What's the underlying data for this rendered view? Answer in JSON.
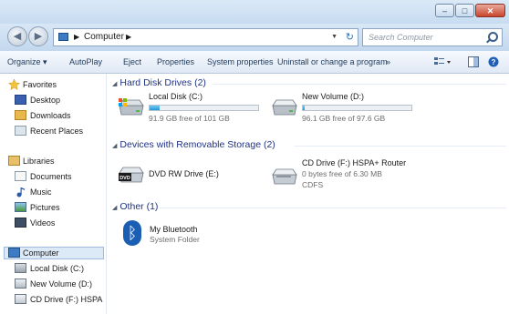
{
  "window": {
    "caption_buttons": [
      "–",
      "□",
      "✕"
    ]
  },
  "address_bar": {
    "path_label": "Computer",
    "search_placeholder": "Search Computer"
  },
  "toolbar": {
    "organize": "Organize ▾",
    "autoplay": "AutoPlay",
    "eject": "Eject",
    "properties": "Properties",
    "system_properties": "System properties",
    "uninstall": "Uninstall or change a program",
    "more": "»"
  },
  "sidebar": {
    "favorites": "Favorites",
    "desktop": "Desktop",
    "downloads": "Downloads",
    "recent": "Recent Places",
    "libraries": "Libraries",
    "documents": "Documents",
    "music": "Music",
    "pictures": "Pictures",
    "videos": "Videos",
    "computer": "Computer",
    "local_disk": "Local Disk (C:)",
    "new_volume": "New Volume (D:)",
    "cd_drive": "CD Drive (F:) HSPA"
  },
  "groups": {
    "hard_disk": "Hard Disk Drives (2)",
    "removable": "Devices with Removable Storage (2)",
    "other": "Other (1)"
  },
  "drives": {
    "c": {
      "name": "Local Disk (C:)",
      "free": "91.9 GB free of 101 GB",
      "used_fraction": 0.09
    },
    "d": {
      "name": "New Volume (D:)",
      "free": "96.1 GB free of 97.6 GB",
      "used_fraction": 0.015
    },
    "e": {
      "name": "DVD RW Drive (E:)"
    },
    "f": {
      "name": "CD Drive (F:) HSPA+ Router",
      "free": "0 bytes free of 6.30 MB",
      "fs": "CDFS"
    }
  },
  "other": {
    "bluetooth_name": "My Bluetooth",
    "bluetooth_type": "System Folder"
  }
}
